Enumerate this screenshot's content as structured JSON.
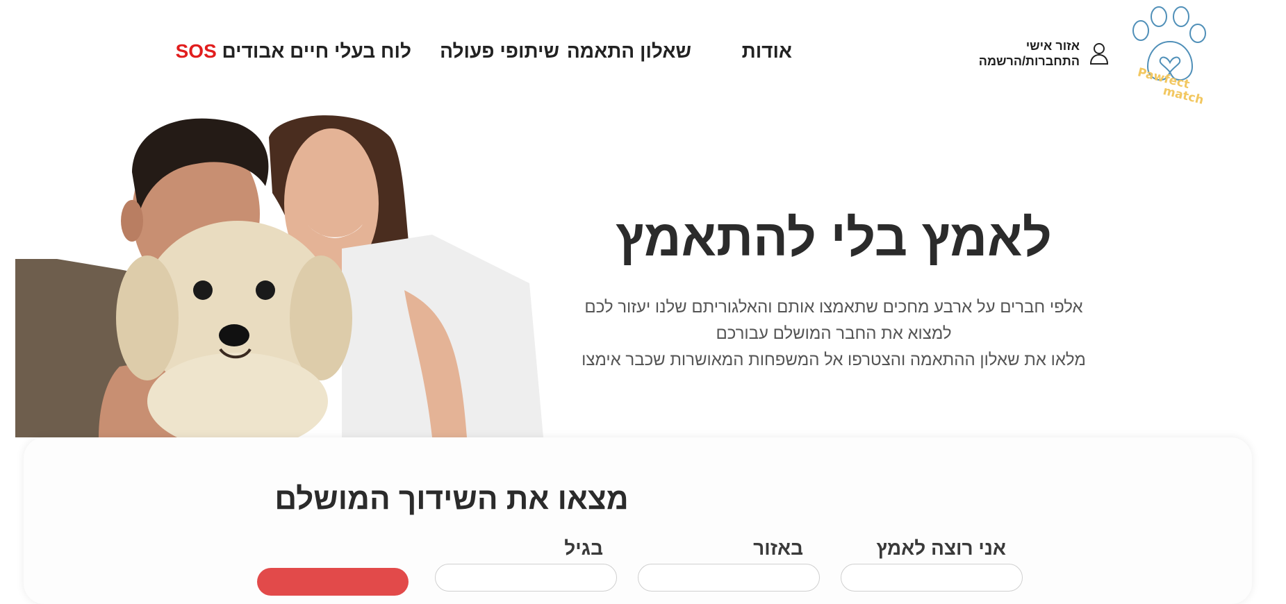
{
  "header": {
    "logo_text_line1": "Pawfect",
    "logo_text_line2": "match",
    "account": {
      "title": "אזור אישי",
      "subtitle": "התחברות/הרשמה",
      "icon": "user-icon"
    },
    "nav": {
      "about": "אודות",
      "quiz": "שאלון התאמה",
      "partners": "שיתופי פעולה",
      "board_text": "לוח בעלי חיים אבודים",
      "board_sos": "SOS"
    }
  },
  "hero": {
    "title": "לאמץ בלי להתאמץ",
    "desc_line1": "אלפי חברים על ארבע מחכים שתאמצו אותם והאלגוריתם שלנו יעזור לכם",
    "desc_line2": "למצוא את החבר המושלם עבורכם",
    "desc_line3": "מלאו את שאלון ההתאמה והצטרפו אל המשפחות המאושרות שכבר אימצו"
  },
  "match": {
    "title": "מצאו את השידוך המושלם",
    "labels": {
      "adopt": "אני רוצה לאמץ",
      "area": "באזור",
      "age": "בגיל"
    }
  },
  "colors": {
    "sos": "#e11d1d",
    "logo_outline": "#4f8fb8",
    "logo_text": "#f2c760",
    "search_button": "#e24a4a"
  }
}
